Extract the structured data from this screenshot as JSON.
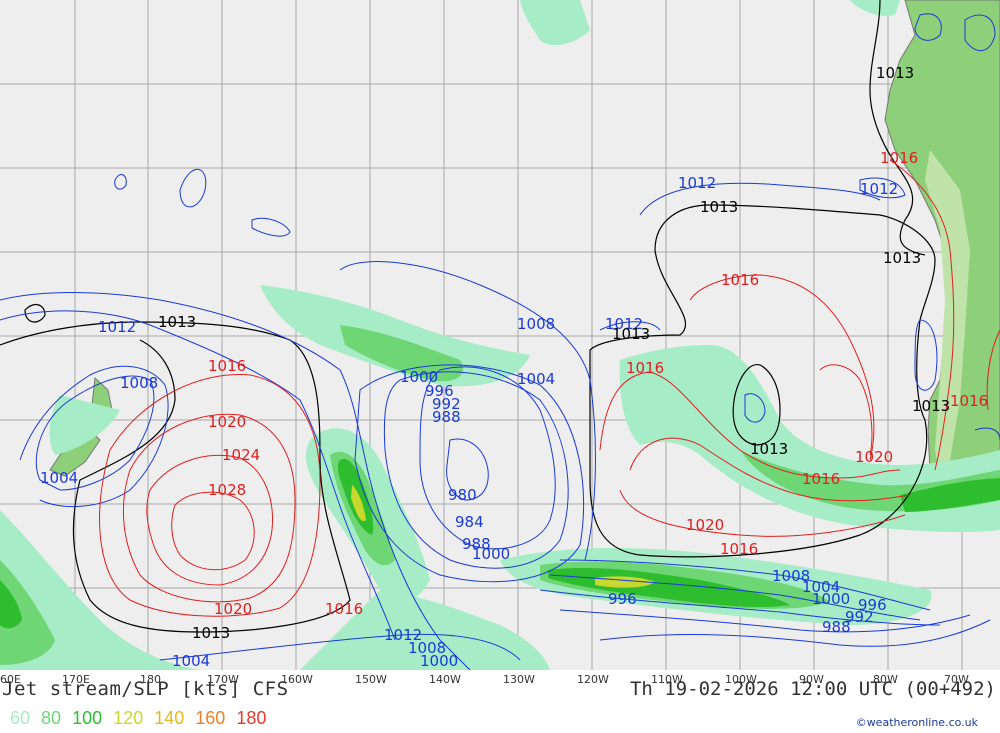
{
  "title": "Jet stream/SLP [kts] CFS",
  "datetime": "Th 19-02-2026 12:00 UTC (00+492)",
  "credit": "©weatheronline.co.uk",
  "legend": [
    {
      "label": "60",
      "color": "#a6ecc6"
    },
    {
      "label": "80",
      "color": "#6ed674"
    },
    {
      "label": "100",
      "color": "#2ebd2e"
    },
    {
      "label": "120",
      "color": "#c8d82e"
    },
    {
      "label": "140",
      "color": "#e8b81e"
    },
    {
      "label": "160",
      "color": "#ee7f24"
    },
    {
      "label": "180",
      "color": "#e83a2c"
    }
  ],
  "longitudes": [
    "60E",
    "170E",
    "180",
    "170W",
    "160W",
    "150W",
    "140W",
    "130W",
    "120W",
    "110W",
    "100W",
    "90W",
    "80W",
    "70W"
  ],
  "isobars": {
    "blue": [
      "1012",
      "1008",
      "1004",
      "1012",
      "1008",
      "1004",
      "1000",
      "996",
      "992",
      "988",
      "980",
      "984",
      "988",
      "1000",
      "1012",
      "1012",
      "1008",
      "1004",
      "1000",
      "996",
      "992",
      "988",
      "1012",
      "1008",
      "1004",
      "1000",
      "996",
      "992",
      "988"
    ],
    "black": [
      "1013",
      "1013",
      "1013",
      "1013",
      "1013",
      "1013",
      "1013",
      "1013"
    ],
    "red": [
      "1016",
      "1020",
      "1024",
      "1028",
      "1020",
      "1016",
      "1016",
      "1016",
      "1016",
      "1020",
      "1016",
      "1016",
      "1020",
      "1016"
    ]
  }
}
